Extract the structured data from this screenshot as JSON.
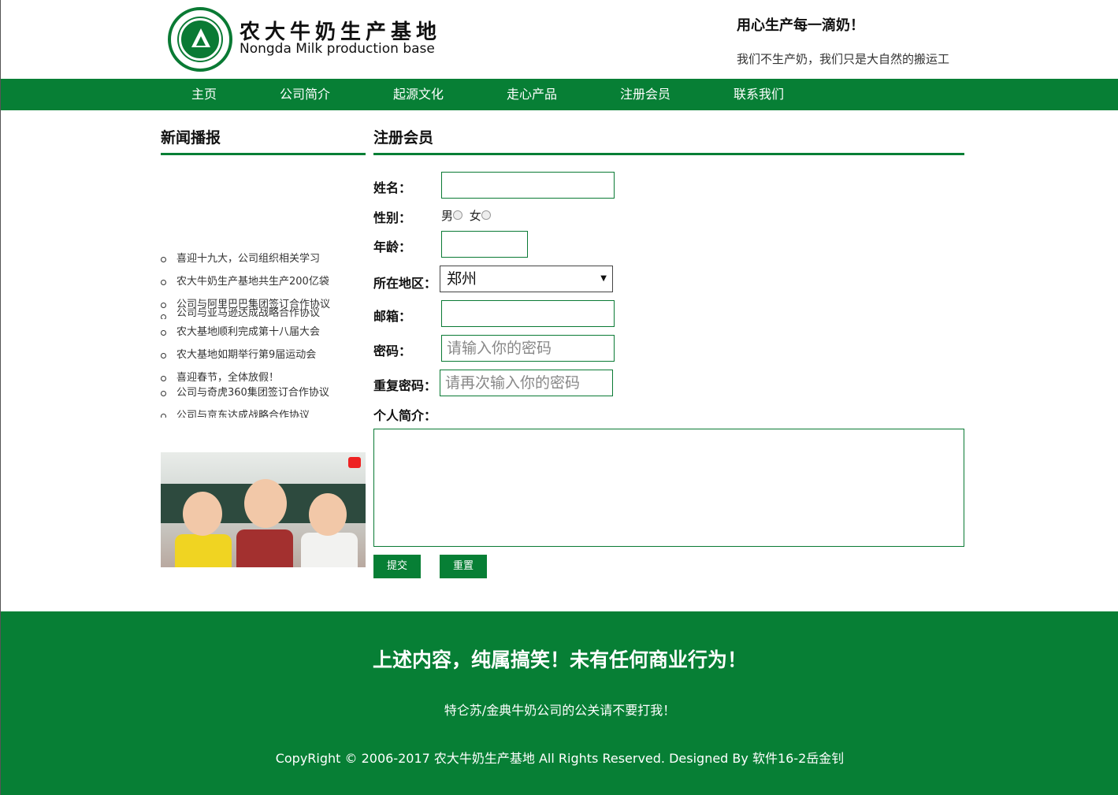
{
  "header": {
    "logo_title": "农大牛奶生产基地",
    "logo_subtitle": "Nongda Milk production base",
    "slogan": "用心生产每一滴奶！",
    "slogan_sub": "我们不生产奶，我们只是大自然的搬运工"
  },
  "nav": [
    "主页",
    "公司简介",
    "起源文化",
    "走心产品",
    "注册会员",
    "联系我们"
  ],
  "sidebar": {
    "title": "新闻播报",
    "news": [
      "喜迎十九大，公司组织相关学习",
      "农大牛奶生产基地共生产200亿袋",
      "公司与阿里巴巴集团签订合作协议",
      "公司与亚马逊达成战略合作协议",
      "农大基地顺利完成第十八届大会",
      "农大基地如期举行第9届运动会",
      "喜迎春节，全体放假！",
      "公司与奇虎360集团签订合作协议",
      "公司与京东达成战略合作协议"
    ]
  },
  "form": {
    "title": "注册会员",
    "name_label": "姓名：",
    "gender_label": "性别：",
    "gender_male": "男",
    "gender_female": "女",
    "age_label": "年龄：",
    "region_label": "所在地区：",
    "region_value": "郑州",
    "email_label": "邮箱：",
    "password_label": "密码：",
    "password_placeholder": "请输入你的密码",
    "repeat_label": "重复密码：",
    "repeat_placeholder": "请再次输入你的密码",
    "intro_label": "个人简介：",
    "submit": "提交",
    "reset": "重置"
  },
  "footer": {
    "line1": "上述内容，纯属搞笑！未有任何商业行为！",
    "line2": "特仑苏/金典牛奶公司的公关请不要打我！",
    "line3": "CopyRight © 2006-2017 农大牛奶生产基地 All Rights Reserved. Designed By 软件16-2岳金钊"
  },
  "colors": {
    "brand_green": "#077f35"
  },
  "icons": [
    "university-seal-logo",
    "dropdown-caret-icon",
    "video-play-icon"
  ]
}
